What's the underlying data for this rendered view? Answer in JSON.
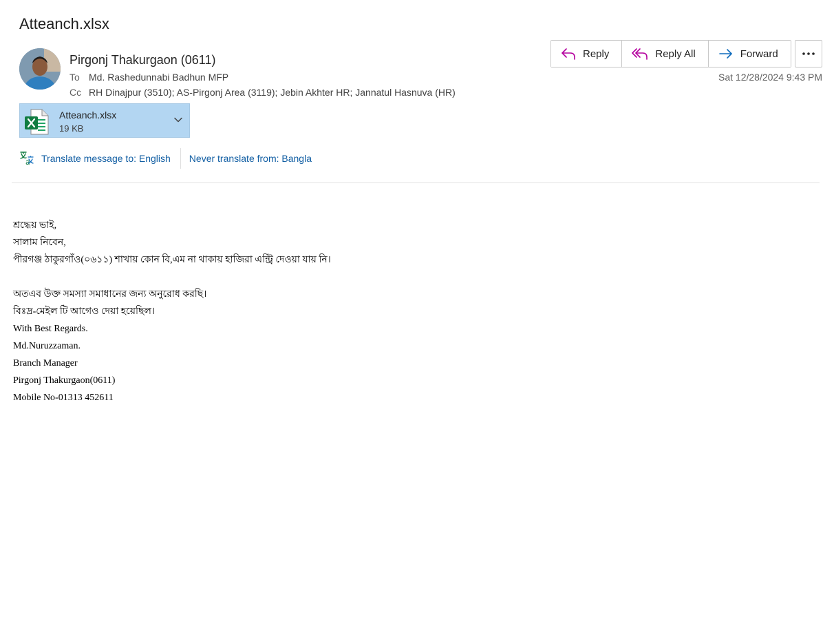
{
  "email": {
    "subject": "Atteanch.xlsx",
    "sender": "Pirgonj  Thakurgaon (0611)",
    "to_label": "To",
    "to": "Md. Rashedunnabi Badhun MFP",
    "cc_label": "Cc",
    "cc": "RH Dinajpur (3510); AS-Pirgonj Area (3119); Jebin  Akhter HR; Jannatul Hasnuva (HR)",
    "date": "Sat 12/28/2024 9:43 PM"
  },
  "actions": {
    "reply": "Reply",
    "reply_all": "Reply All",
    "forward": "Forward"
  },
  "attachment": {
    "name": "Atteanch.xlsx",
    "size": "19 KB",
    "icon": "excel-file-icon"
  },
  "translate": {
    "translate_label": "Translate message to: English",
    "never_label": "Never translate from: Bangla"
  },
  "body": {
    "lines": [
      "শ্রদ্ধেয় ভাই,",
      "সালাম নিবেন,",
      "পীরগঞ্জ ঠাকুরগাঁও(০৬১১) শাখায় কোন বি,এম না থাকায় হাজিরা এন্ট্রি দেওয়া যায় নি।",
      "",
      "অতএব উক্ত সমস্যা সমাধানের জন্য অনুরোধ করছি।",
      "বিঃদ্র-মেইল টি আগেও দেয়া হয়েছিল।",
      "With Best Regards.",
      "Md.Nuruzzaman.",
      "Branch Manager",
      "Pirgonj Thakurgaon(0611)",
      "Mobile No-01313 452611"
    ]
  },
  "colors": {
    "link": "#115ea3",
    "attachment_bg": "#b3d6f2",
    "reply_icon": "#b4009e",
    "forward_icon": "#0f6cbd"
  }
}
